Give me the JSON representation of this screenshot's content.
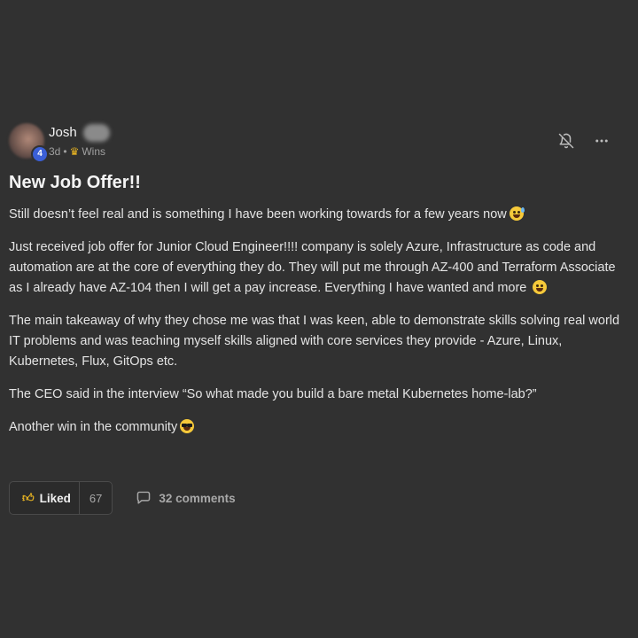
{
  "post": {
    "author": {
      "name": "Josh",
      "level": "4"
    },
    "meta": {
      "time": "3d",
      "separator": "•",
      "category": "Wins"
    },
    "title": "New Job Offer!!",
    "paragraphs": [
      "Still doesn’t feel real and is something I have been working towards for a few years now",
      "Just received job offer for Junior Cloud Engineer!!!! company is solely Azure, Infrastructure as code and automation are at the core of everything they do. They will put me through AZ-400 and Terraform Associate as I already have AZ-104 then I will get a pay increase. Everything I have wanted and more",
      "The main takeaway of why they chose me was that I was keen, able to demonstrate skills solving real world IT problems and was teaching myself skills aligned with core services they provide - Azure, Linux, Kubernetes, Flux, GitOps etc.",
      "The CEO said in the interview “So what made you build a bare metal Kubernetes home-lab?”",
      "Another win in the community"
    ],
    "actions": {
      "like_label": "Liked",
      "like_count": "67",
      "comments_label": "32 comments"
    }
  },
  "icons": {
    "crown": "crown-icon",
    "bell": "bell-off-icon",
    "more": "more-horizontal-icon",
    "thumb": "thumbs-up-icon",
    "comment": "comment-bubble-icon"
  },
  "colors": {
    "background": "#313131",
    "text": "#e4e4e4",
    "muted": "#a8a8a8",
    "accent_gold": "#e8b422",
    "level_badge": "#3b5fd6"
  }
}
